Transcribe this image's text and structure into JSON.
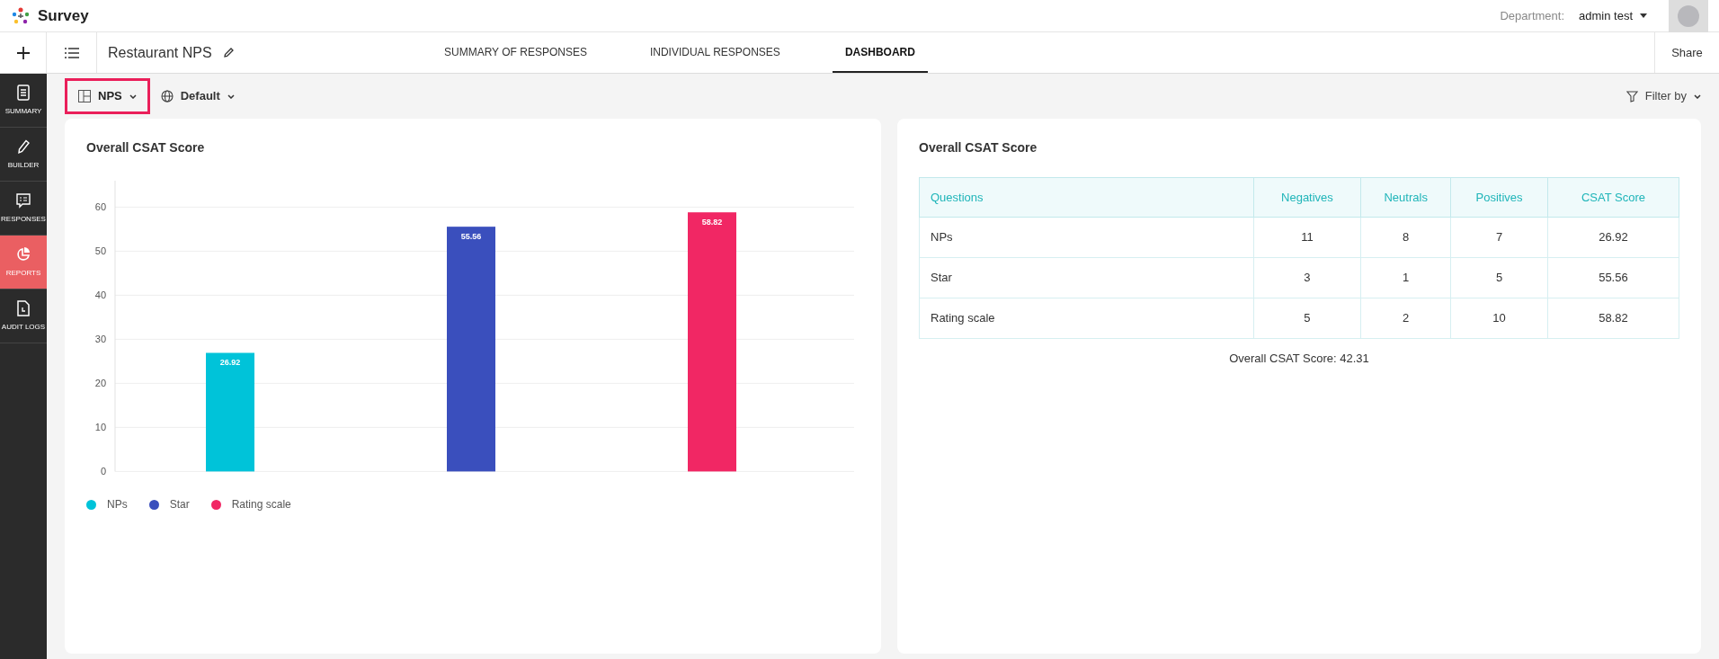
{
  "app_bar": {
    "brand": "Survey",
    "department_label": "Department:",
    "department_value": "admin test"
  },
  "header": {
    "title": "Restaurant NPS",
    "tabs": [
      {
        "label": "SUMMARY OF RESPONSES",
        "selected": false
      },
      {
        "label": "INDIVIDUAL RESPONSES",
        "selected": false
      },
      {
        "label": "DASHBOARD",
        "selected": true
      }
    ],
    "share": "Share"
  },
  "sidebar": {
    "items": [
      {
        "label": "SUMMARY",
        "kind": "summary",
        "selected": false
      },
      {
        "label": "BUILDER",
        "kind": "builder",
        "selected": false
      },
      {
        "label": "RESPONSES",
        "kind": "responses",
        "selected": false
      },
      {
        "label": "REPORTS",
        "kind": "reports",
        "selected": true
      },
      {
        "label": "AUDIT LOGS",
        "kind": "audit",
        "selected": false
      }
    ]
  },
  "toolbar": {
    "view_selector": {
      "label": "NPS",
      "highlighted": true
    },
    "language_selector": {
      "label": "Default"
    },
    "filter": {
      "label": "Filter by"
    }
  },
  "chart_panel": {
    "title": "Overall CSAT Score",
    "chart_data": {
      "type": "bar",
      "grid": true,
      "data_labels": true,
      "ylim": [
        0,
        66
      ],
      "yticks": [
        0,
        10,
        20,
        30,
        40,
        50,
        60
      ],
      "series": [
        {
          "name": "NPs",
          "color": "#00c3d9",
          "values": [
            26.92,
            null,
            null
          ]
        },
        {
          "name": "Star",
          "color": "#3a4fbd",
          "values": [
            null,
            55.56,
            null
          ]
        },
        {
          "name": "Rating scale",
          "color": "#f12764",
          "values": [
            null,
            null,
            58.82
          ]
        }
      ]
    }
  },
  "table_panel": {
    "title": "Overall CSAT Score",
    "table": {
      "columns": [
        "Questions",
        "Negatives",
        "Neutrals",
        "Positives",
        "CSAT Score"
      ],
      "rows": [
        [
          "NPs",
          "11",
          "8",
          "7",
          "26.92"
        ],
        [
          "Star",
          "3",
          "1",
          "5",
          "55.56"
        ],
        [
          "Rating scale",
          "5",
          "2",
          "10",
          "58.82"
        ]
      ]
    },
    "footer": "Overall CSAT Score: 42.31"
  }
}
